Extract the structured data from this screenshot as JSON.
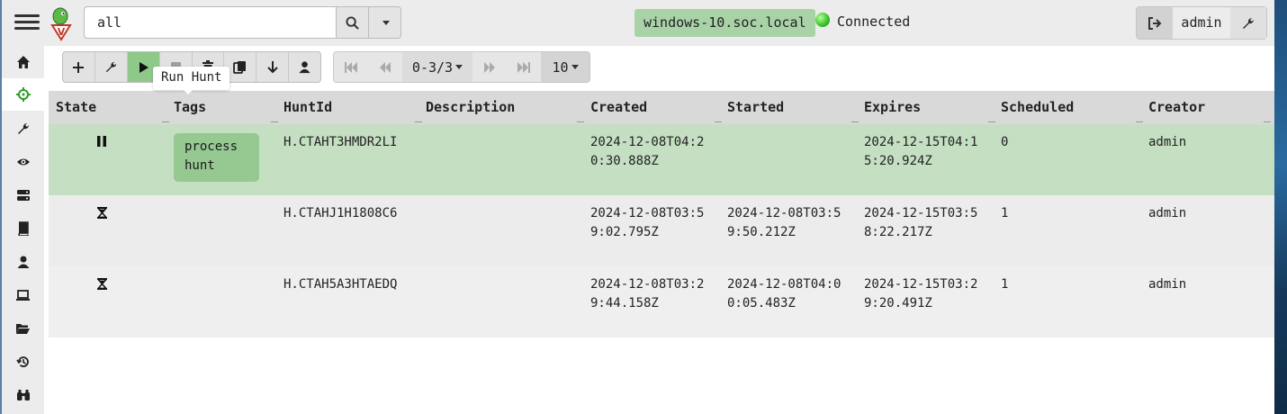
{
  "search": {
    "value": "all"
  },
  "tooltip": {
    "text": "Run Hunt"
  },
  "status": {
    "host": "windows-10.soc.local",
    "connection": "Connected"
  },
  "user": {
    "name": "admin"
  },
  "pager": {
    "range": "0-3/3",
    "page_size": "10"
  },
  "table": {
    "columns": [
      "State",
      "Tags",
      "HuntId",
      "Description",
      "Created",
      "Started",
      "Expires",
      "Scheduled",
      "Creator"
    ],
    "rows": [
      {
        "state": "paused",
        "tags": "process hunt",
        "hunt_id": "H.CTAHT3HMDR2LI",
        "description": "",
        "created": "2024-12-08T04:20:30.888Z",
        "started": "",
        "expires": "2024-12-15T04:15:20.924Z",
        "scheduled": "0",
        "creator": "admin"
      },
      {
        "state": "running",
        "tags": "",
        "hunt_id": "H.CTAHJ1H1808C6",
        "description": "",
        "created": "2024-12-08T03:59:02.795Z",
        "started": "2024-12-08T03:59:50.212Z",
        "expires": "2024-12-15T03:58:22.217Z",
        "scheduled": "1",
        "creator": "admin"
      },
      {
        "state": "running",
        "tags": "",
        "hunt_id": "H.CTAH5A3HTAEDQ",
        "description": "",
        "created": "2024-12-08T03:29:44.158Z",
        "started": "2024-12-08T04:00:05.483Z",
        "expires": "2024-12-15T03:29:20.491Z",
        "scheduled": "1",
        "creator": "admin"
      }
    ]
  },
  "icons": {
    "sidebar": [
      "home-icon",
      "crosshair-icon",
      "wrench-icon",
      "eye-icon",
      "server-icon",
      "book-icon",
      "user-icon",
      "laptop-icon",
      "folder-open-icon",
      "history-icon",
      "binoculars-icon"
    ],
    "toolbar": [
      "plus-icon",
      "wrench-icon",
      "play-icon",
      "stop-icon",
      "trash-icon",
      "copy-icon",
      "download-icon",
      "user-icon"
    ]
  },
  "colors": {
    "selected_row": "#c5dfc3",
    "run_button": "#8ec98a",
    "tag": "#96c892",
    "host_chip": "#a9d3a6"
  }
}
